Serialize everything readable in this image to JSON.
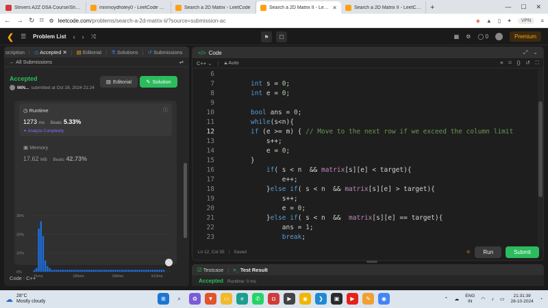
{
  "browser": {
    "tabs": [
      {
        "title": "Strivers A2Z DSA Course/Sheet - C",
        "color": "#d23b3b"
      },
      {
        "title": "minmoydholey0 - LeetCode Profile",
        "color": "#ffa116"
      },
      {
        "title": "Search a 2D Matrix - LeetCode",
        "color": "#ffa116"
      },
      {
        "title": "Search a 2D Matrix II - LeetCo",
        "color": "#ffa116"
      },
      {
        "title": "Search a 2D Matrix II - LeetCode - t",
        "color": "#ffa116"
      }
    ],
    "new_tab": "+",
    "url_host": "leetcode.com",
    "url_path": "/problems/search-a-2d-matrix-ii/?source=submission-ac",
    "vpn": "VPN"
  },
  "leetcode": {
    "problem_list": "Problem List",
    "streak": "0",
    "premium": "Premium"
  },
  "left": {
    "tabs": {
      "description": "scription",
      "accepted": "Accepted",
      "editorial": "Editorial",
      "solutions": "Solutions",
      "submissions": "Submissions"
    },
    "all_submissions": "All Submissions",
    "status": "Accepted",
    "user": "MIN...",
    "submitted": "submitted at Oct 28, 2024 21:24",
    "editorial_btn": "Editorial",
    "solution_btn": "Solution",
    "runtime_label": "Runtime",
    "runtime_value": "1273",
    "runtime_unit": "ms",
    "runtime_beats_label": "Beats",
    "runtime_beats": "5.33%",
    "analyze": "Analyze Complexity",
    "memory_label": "Memory",
    "memory_value": "17.62",
    "memory_unit": "MB",
    "memory_beats_label": "Beats",
    "memory_beats": "42.73%",
    "footer": {
      "code": "Code",
      "lang": "C++"
    }
  },
  "chart_data": {
    "type": "bar",
    "title": "",
    "xlabel": "",
    "ylabel": "",
    "ylim": [
      0,
      30
    ],
    "yticks": [
      "0%",
      "10%",
      "20%",
      "30%"
    ],
    "xticks": [
      "21ms",
      "185ms",
      "349ms",
      "513ms"
    ],
    "mini_xticks": [
      "21ms",
      "185ms",
      "349ms",
      "513ms"
    ],
    "xlim": [
      21,
      560
    ],
    "values": [
      1,
      2,
      23,
      27,
      19,
      6,
      3,
      2,
      1,
      1,
      1,
      1,
      1,
      1,
      1,
      1,
      1,
      1,
      1,
      1,
      1,
      1,
      1,
      1,
      1,
      1,
      1,
      1,
      1,
      1,
      1,
      1,
      1,
      1,
      1,
      1,
      1,
      1,
      1,
      1,
      1,
      1,
      1,
      1,
      1,
      1,
      1,
      1,
      1,
      1,
      1,
      1,
      1,
      1,
      1,
      1,
      1,
      1,
      1,
      1
    ],
    "highlight_color": "#2d7ff9",
    "bar_color": "#1d6fe0"
  },
  "editor": {
    "title": "Code",
    "language": "C++",
    "mode": "Auto",
    "lines": [
      {
        "n": "6",
        "t": ""
      },
      {
        "n": "7",
        "t": "int s = 0;"
      },
      {
        "n": "8",
        "t": "int e = 0;"
      },
      {
        "n": "9",
        "t": ""
      },
      {
        "n": "10",
        "t": "bool ans = 0;"
      },
      {
        "n": "11",
        "t": "while(s<n){"
      },
      {
        "n": "12",
        "t": "if (e >= m) { // Move to the next row if we exceed the column limit"
      },
      {
        "n": "13",
        "t": "    s++;"
      },
      {
        "n": "14",
        "t": "    e = 0;"
      },
      {
        "n": "15",
        "t": "}"
      },
      {
        "n": "16",
        "t": "    if( s < n  && matrix[s][e] < target){"
      },
      {
        "n": "17",
        "t": "        e++;"
      },
      {
        "n": "18",
        "t": "    }else if( s < n  && matrix[s][e] > target){"
      },
      {
        "n": "19",
        "t": "        s++;"
      },
      {
        "n": "20",
        "t": "        e = 0;"
      },
      {
        "n": "21",
        "t": "    }else if( s < n  &&  matrix[s][e] == target){"
      },
      {
        "n": "22",
        "t": "        ans = 1;"
      },
      {
        "n": "23",
        "t": "        break;"
      }
    ],
    "status": "Ln 12, Col 35",
    "saved": "Saved",
    "run": "Run",
    "submit": "Submit"
  },
  "testpanel": {
    "testcase": "Testcase",
    "test_result": "Test Result",
    "accepted": "Accepted",
    "runtime": "Runtime: 0 ms"
  },
  "taskbar": {
    "temp": "28°C",
    "weather": "Mostly cloudy",
    "lang1": "ENG",
    "lang2": "IN",
    "time": "21:31:39",
    "date": "28-10-2024"
  }
}
